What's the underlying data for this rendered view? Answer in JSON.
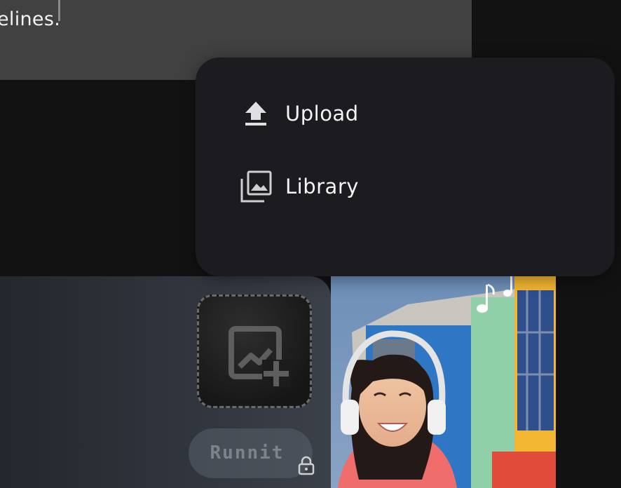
{
  "editor": {
    "visible_text": "elines."
  },
  "menu": {
    "items": [
      {
        "label": "Upload",
        "icon": "upload-icon"
      },
      {
        "label": "Library",
        "icon": "image-library-icon"
      }
    ]
  },
  "uploader": {
    "dropzone_icon": "add-image-icon",
    "run_label": "Runnit",
    "lock_icon": "lock-icon"
  },
  "preview": {
    "image": "smiling-woman-with-headphones-photo",
    "decoration_icon": "music-notes-icon"
  },
  "colors": {
    "menu_bg": "#1c1b20",
    "page_bg": "#121213",
    "text_panel_bg": "#414141"
  }
}
